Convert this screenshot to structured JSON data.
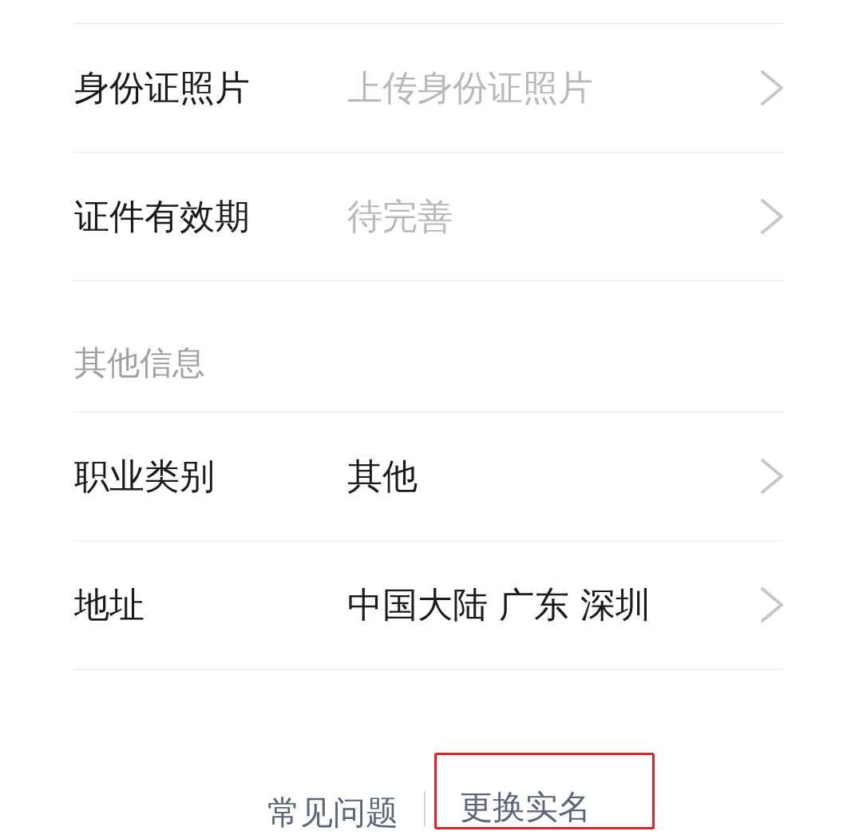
{
  "sections": [
    {
      "rows": [
        {
          "label": "身份证照片",
          "value": "上传身份证照片",
          "muted": true
        },
        {
          "label": "证件有效期",
          "value": "待完善",
          "muted": true
        }
      ]
    },
    {
      "title": "其他信息",
      "rows": [
        {
          "label": "职业类别",
          "value": "其他",
          "muted": false
        },
        {
          "label": "地址",
          "value": "中国大陆 广东 深圳",
          "muted": false
        }
      ]
    }
  ],
  "footer_links": [
    {
      "label": "常见问题",
      "highlighted": false
    },
    {
      "label": "更换实名",
      "highlighted": true
    }
  ]
}
